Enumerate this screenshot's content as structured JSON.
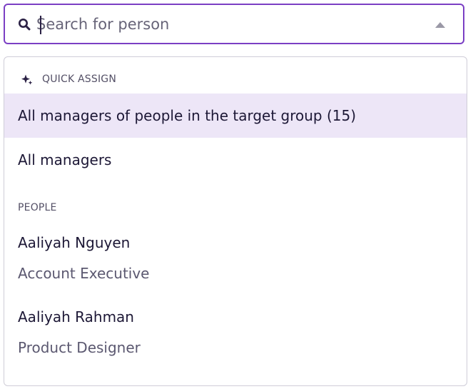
{
  "search": {
    "placeholder": "Search for person",
    "search_icon": "search-icon",
    "toggle_icon": "chevron-up-icon"
  },
  "quick_assign": {
    "header": "QUICK ASSIGN",
    "icon": "sparkle-icon",
    "options": [
      {
        "label": "All managers of people in the target group (15)",
        "highlighted": true
      },
      {
        "label": "All managers",
        "highlighted": false
      }
    ]
  },
  "people": {
    "header": "PEOPLE",
    "items": [
      {
        "name": "Aaliyah Nguyen",
        "title": "Account Executive"
      },
      {
        "name": "Aaliyah Rahman",
        "title": "Product Designer"
      }
    ]
  },
  "colors": {
    "focus_border": "#7b3fc4",
    "highlight_bg": "#ede6f7",
    "text_primary": "#1d1836",
    "text_secondary": "#5b5870"
  }
}
